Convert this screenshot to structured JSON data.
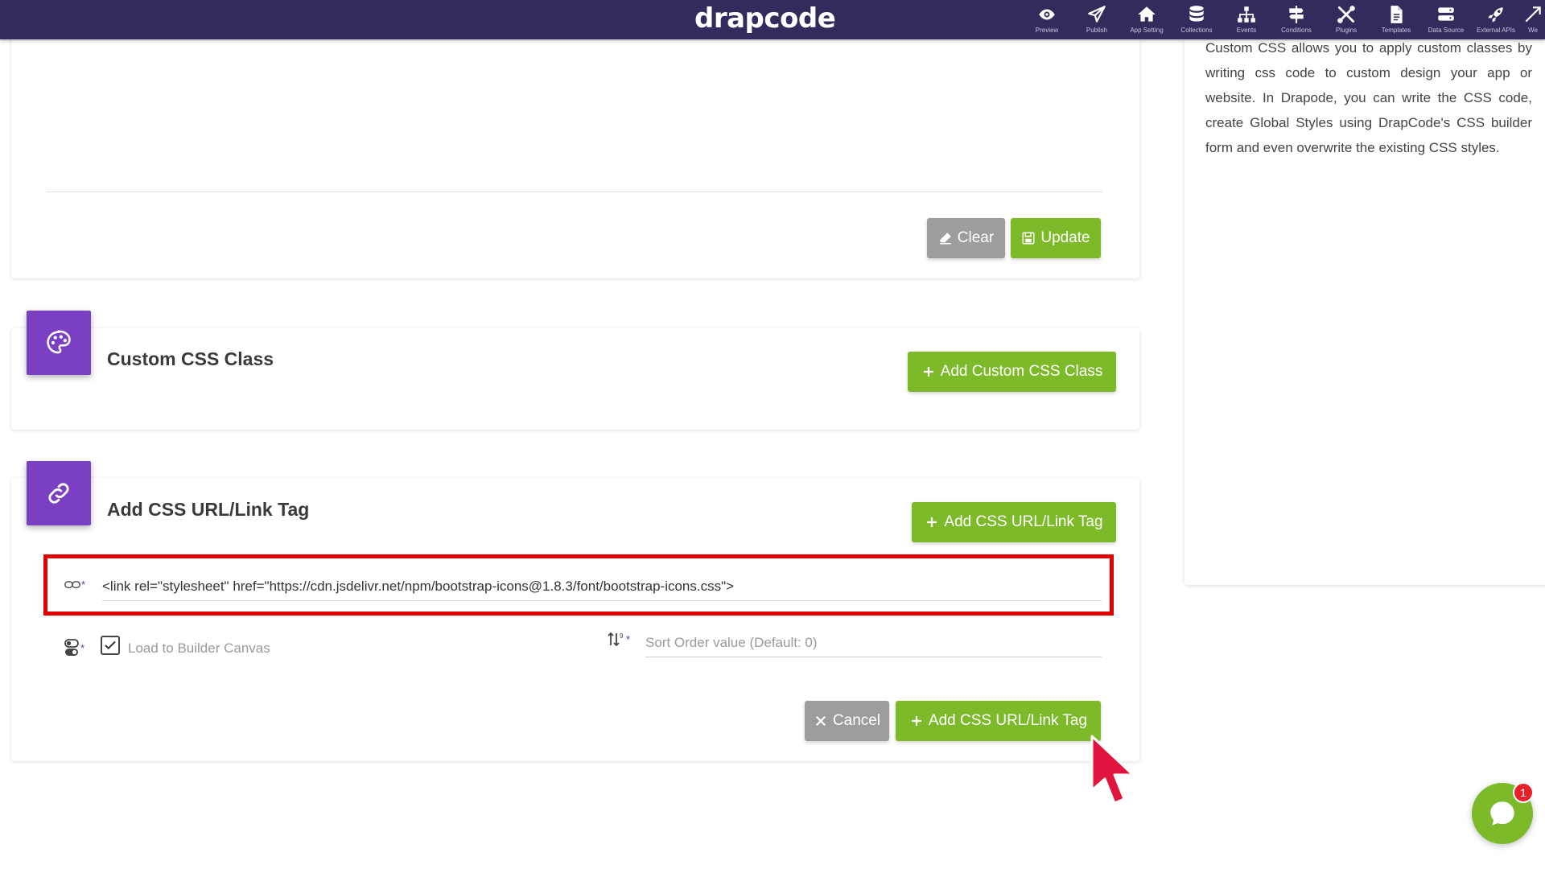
{
  "app": {
    "logo": "drapcode"
  },
  "nav": [
    {
      "label": "Preview",
      "icon": "eye-icon"
    },
    {
      "label": "Publish",
      "icon": "paper-plane-icon"
    },
    {
      "label": "App Setting",
      "icon": "home-icon"
    },
    {
      "label": "Collections",
      "icon": "database-icon"
    },
    {
      "label": "Events",
      "icon": "sitemap-icon"
    },
    {
      "label": "Conditions",
      "icon": "signpost-icon"
    },
    {
      "label": "Plugins",
      "icon": "tools-icon"
    },
    {
      "label": "Templates",
      "icon": "file-icon"
    },
    {
      "label": "Data Source",
      "icon": "server-icon"
    },
    {
      "label": "External APIs",
      "icon": "rocket-icon"
    },
    {
      "label": "We",
      "icon": "arrow-icon"
    }
  ],
  "top_section": {
    "clear_label": "Clear",
    "update_label": "Update"
  },
  "css_class_section": {
    "title": "Custom CSS Class",
    "add_label": "Add Custom CSS Class"
  },
  "link_tag_section": {
    "title": "Add CSS URL/Link Tag",
    "add_label": "Add CSS URL/Link Tag",
    "url_value": "<link rel=\"stylesheet\" href=\"https://cdn.jsdelivr.net/npm/bootstrap-icons@1.8.3/font/bootstrap-icons.css\">",
    "load_label": "Load to Builder Canvas",
    "load_checked": true,
    "sort_placeholder": "Sort Order value (Default: 0)",
    "cancel_label": "Cancel",
    "submit_label": "Add CSS URL/Link Tag"
  },
  "side_panel": {
    "text": "Custom CSS allows you to apply custom classes by writing css code to custom design your app or website. In Drapode, you can write the CSS code, create Global Styles using DrapCode's CSS builder form and even overwrite the existing CSS styles."
  },
  "chat": {
    "badge": "1"
  },
  "colors": {
    "topbar": "#332b5c",
    "accent_purple": "#7b3fc4",
    "green": "#7cba2a",
    "gray_button": "#9d9d9d",
    "highlight_red": "#e00000",
    "badge_red": "#e8202b"
  }
}
